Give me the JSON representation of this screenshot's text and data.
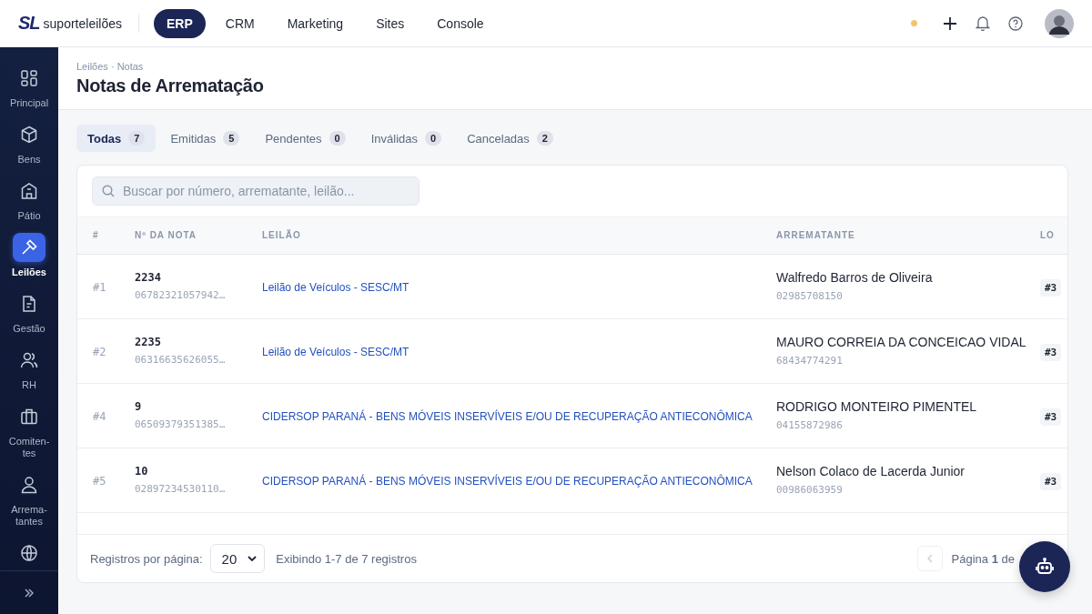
{
  "logo": {
    "mark": "SL",
    "name": "**suporte**leilões"
  },
  "top_nav": [
    {
      "label": "ERP",
      "selected": true
    },
    {
      "label": "CRM",
      "selected": false
    },
    {
      "label": "Marketing",
      "selected": false
    },
    {
      "label": "Sites",
      "selected": false
    },
    {
      "label": "Console",
      "selected": false
    }
  ],
  "sidebar": {
    "items": [
      {
        "label": "Principal",
        "selected": false
      },
      {
        "label": "Bens",
        "selected": false
      },
      {
        "label": "Pátio",
        "selected": false
      },
      {
        "label": "Leilões",
        "selected": true
      },
      {
        "label": "Gestão",
        "selected": false
      },
      {
        "label": "RH",
        "selected": false
      },
      {
        "label": "Comiten-tes",
        "selected": false
      },
      {
        "label": "Arrema-tantes",
        "selected": false
      },
      {
        "selected": false
      }
    ]
  },
  "breadcrumb": "Leilões · Notas",
  "title": "Notas de Arrematação",
  "tabs": [
    {
      "label": "Todas",
      "count": "7",
      "selected": true
    },
    {
      "label": "Emitidas",
      "count": "5",
      "selected": false
    },
    {
      "label": "Pendentes",
      "count": "0",
      "selected": false
    },
    {
      "label": "Inválidas",
      "count": "0",
      "selected": false
    },
    {
      "label": "Canceladas",
      "count": "2",
      "selected": false
    }
  ],
  "search": {
    "placeholder": "Buscar por número, arrematante, leilão..."
  },
  "table": {
    "columns": [
      "#",
      "Nº DA NOTA",
      "LEILÃO",
      "ARREMATANTE",
      "LO"
    ],
    "rows": [
      {
        "index": "#1",
        "number": "2234",
        "key": "06782321057942…",
        "auction": "Leilão de Veículos - SESC/MT",
        "buyer": "Walfredo Barros de Oliveira",
        "doc": "02985708150",
        "lot": "#3"
      },
      {
        "index": "#2",
        "number": "2235",
        "key": "06316635626055…",
        "auction": "Leilão de Veículos - SESC/MT",
        "buyer": "MAURO CORREIA DA CONCEICAO VIDAL",
        "doc": "68434774291",
        "lot": "#3"
      },
      {
        "index": "#4",
        "number": "9",
        "key": "06509379351385…",
        "auction": "CIDERSOP PARANÁ - BENS MÓVEIS INSERVÍVEIS E/OU DE RECUPERAÇÃO ANTIECONÔMICA",
        "buyer": "RODRIGO MONTEIRO PIMENTEL",
        "doc": "04155872986",
        "lot": "#3"
      },
      {
        "index": "#5",
        "number": "10",
        "key": "02897234530110…",
        "auction": "CIDERSOP PARANÁ - BENS MÓVEIS INSERVÍVEIS E/OU DE RECUPERAÇÃO ANTIECONÔMICA",
        "buyer": "Nelson Colaco de Lacerda Junior",
        "doc": "00986063959",
        "lot": "#3"
      }
    ]
  },
  "footer": {
    "per_page_label": "Registros por página:",
    "per_page": "20",
    "summary": "Exibindo 1-7 de 7 registros",
    "prev_disabled": true,
    "page": "Página **1** de"
  }
}
